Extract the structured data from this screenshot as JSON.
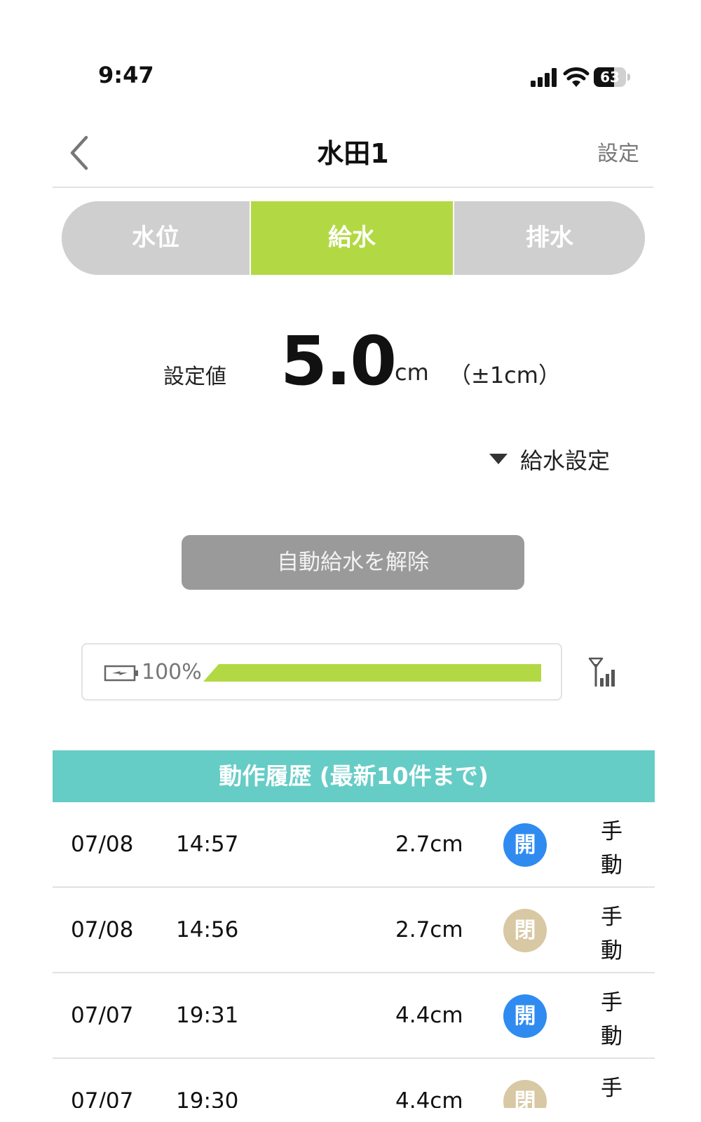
{
  "status_bar": {
    "time": "9:47",
    "battery": "63",
    "battery_level": 0.63
  },
  "header": {
    "title": "水田1",
    "settings": "設定"
  },
  "tabs": [
    {
      "label": "水位",
      "active": false
    },
    {
      "label": "給水",
      "active": true
    },
    {
      "label": "排水",
      "active": false
    }
  ],
  "setpoint": {
    "label": "設定値",
    "value": "5.0",
    "unit": "cm",
    "tolerance": "（±1cm）"
  },
  "supply_settings": {
    "label": "給水設定"
  },
  "cancel_button": {
    "label": "自動給水を解除"
  },
  "battery": {
    "percent_label": "100%",
    "level": 1.0
  },
  "history": {
    "title": "動作履歴 (最新10件まで)",
    "rows": [
      {
        "date": "07/08",
        "time": "14:57",
        "level": "2.7cm",
        "state": "開",
        "state_color": "#2f8bf0",
        "mode": "手動"
      },
      {
        "date": "07/08",
        "time": "14:56",
        "level": "2.7cm",
        "state": "閉",
        "state_color": "#d8c8a3",
        "mode": "手動"
      },
      {
        "date": "07/07",
        "time": "19:31",
        "level": "4.4cm",
        "state": "開",
        "state_color": "#2f8bf0",
        "mode": "手動"
      },
      {
        "date": "07/07",
        "time": "19:30",
        "level": "4.4cm",
        "state": "閉",
        "state_color": "#d8c8a3",
        "mode": "手動"
      }
    ]
  },
  "colors": {
    "accent_green": "#b2d943",
    "history_teal": "#66ccc6",
    "open_blue": "#2f8bf0",
    "closed_beige": "#d8c8a3"
  }
}
